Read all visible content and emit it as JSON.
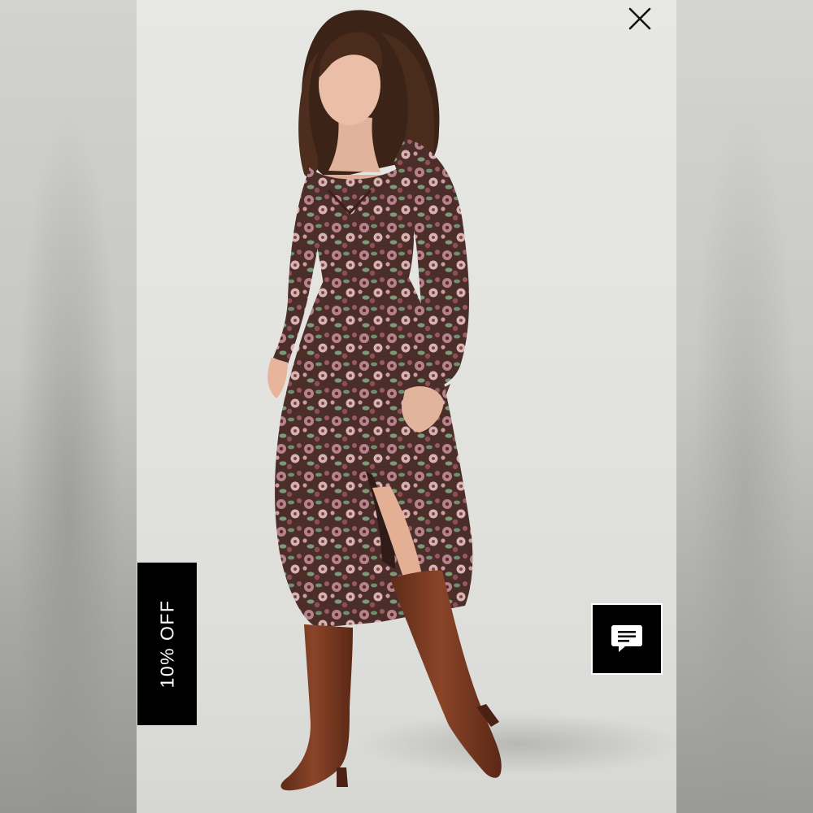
{
  "promo": {
    "label": "10% OFF"
  },
  "icons": {
    "close": "close-icon",
    "chat": "chat-bubble-icon"
  },
  "colors": {
    "promo_background": "#000000",
    "promo_text": "#ffffff",
    "chat_background": "#000000",
    "backdrop": "#e4e4e1",
    "dress_base": "#4a2f2a",
    "boots": "#7a3b22"
  }
}
